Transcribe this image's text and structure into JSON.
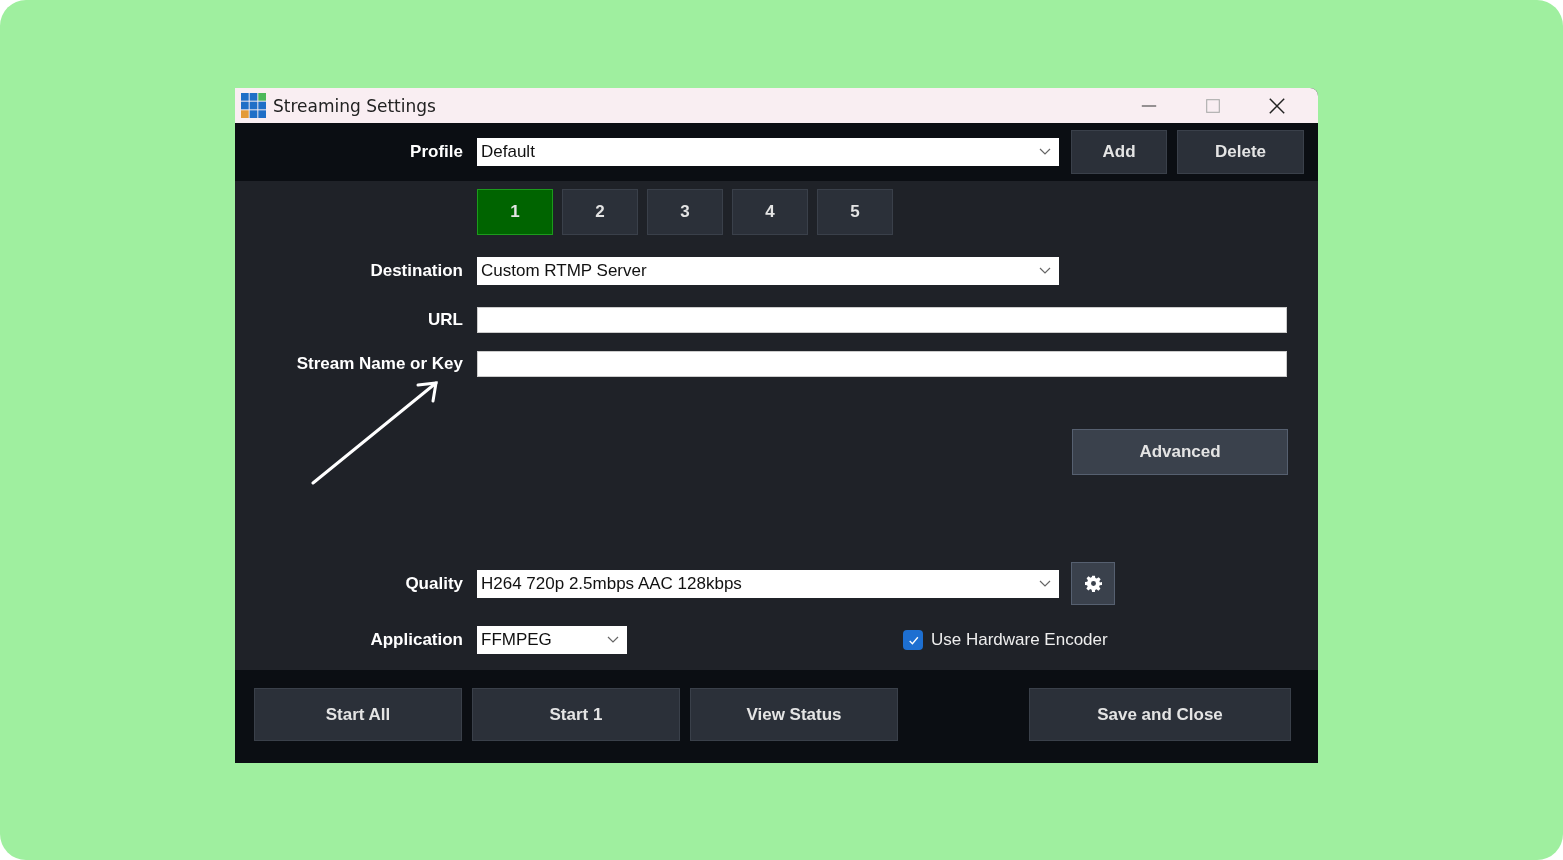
{
  "window": {
    "title": "Streaming Settings"
  },
  "profile": {
    "label": "Profile",
    "value": "Default"
  },
  "profile_buttons": [
    "Add",
    "Delete"
  ],
  "slot_tabs": [
    {
      "label": "1",
      "selected": true
    },
    {
      "label": "2",
      "selected": false
    },
    {
      "label": "3",
      "selected": false
    },
    {
      "label": "4",
      "selected": false
    },
    {
      "label": "5",
      "selected": false
    }
  ],
  "destination": {
    "label": "Destination",
    "value": "Custom RTMP Server"
  },
  "url": {
    "label": "URL"
  },
  "stream_key": {
    "label": "Stream Name or Key"
  },
  "advanced_button": "Advanced",
  "quality": {
    "label": "Quality",
    "value": "H264 720p 2.5mbps AAC 128kbps"
  },
  "application": {
    "label": "Application",
    "value": "FFMPEG"
  },
  "hardware_encoder": {
    "label": "Use Hardware Encoder",
    "checked": true
  },
  "footer_buttons": [
    {
      "label": "Start All",
      "kind": "left"
    },
    {
      "label": "Start 1",
      "kind": "left"
    },
    {
      "label": "View Status",
      "kind": "left"
    },
    {
      "label": "Save and Close",
      "kind": "right"
    }
  ]
}
